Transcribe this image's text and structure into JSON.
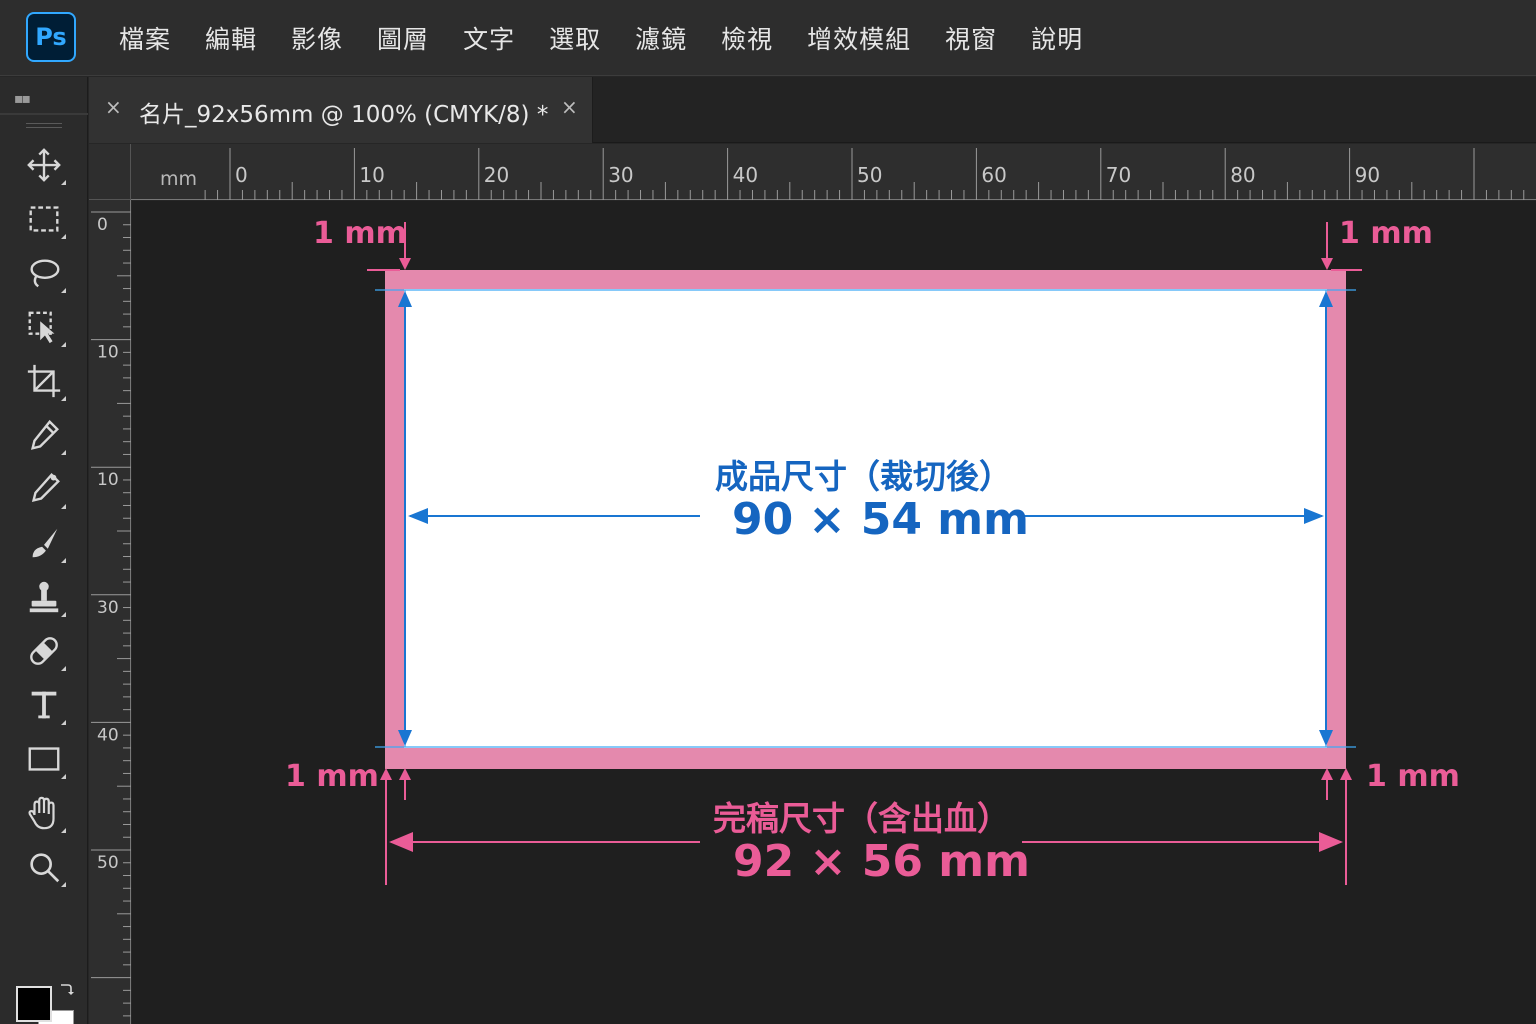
{
  "app": {
    "logo_text": "Ps",
    "menu": [
      "檔案",
      "編輯",
      "影像",
      "圖層",
      "文字",
      "選取",
      "濾鏡",
      "檢視",
      "增效模組",
      "視窗",
      "說明"
    ]
  },
  "document_tab": {
    "title": "名片_92x56mm @ 100% (CMYK/8) *",
    "close_glyph": "×"
  },
  "rulers": {
    "unit": "mm",
    "horizontal_labels": [
      "0",
      "10",
      "20",
      "30",
      "40",
      "50",
      "60",
      "70",
      "80",
      "90"
    ],
    "vertical_labels": [
      "0",
      "10",
      "10",
      "30",
      "40",
      "50"
    ]
  },
  "tools": [
    "move-icon",
    "rectangular-marquee-icon",
    "lasso-icon",
    "object-selection-icon",
    "crop-icon",
    "eyedropper-icon",
    "healing-brush-icon",
    "brush-icon",
    "clone-stamp-icon",
    "spot-healing-icon",
    "type-icon",
    "rectangle-icon",
    "hand-icon",
    "zoom-icon"
  ],
  "colors": {
    "bleed": "#e489ad",
    "trim_guide": "#1976d2",
    "pink_text": "#ea5c97",
    "blue_text": "#1565c0",
    "foreground": "#000000",
    "background": "#ffffff"
  },
  "annotations": {
    "bleed_top_left": "1 mm",
    "bleed_top_right": "1 mm",
    "bleed_bottom_left": "1 mm",
    "bleed_bottom_right": "1 mm",
    "trim_title": "成品尺寸（裁切後）",
    "trim_size": "90 × 54 mm",
    "full_title": "完稿尺寸（含出血）",
    "full_size": "92 × 56 mm"
  }
}
